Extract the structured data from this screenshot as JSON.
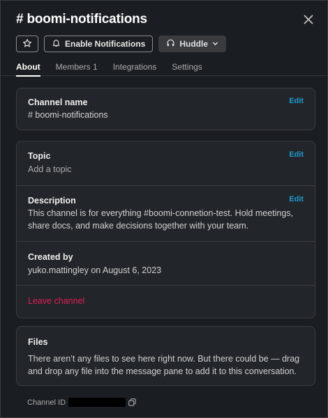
{
  "header": {
    "title": "# boomi-notifications",
    "buttons": {
      "enable_notifications": "Enable Notifications",
      "huddle": "Huddle"
    },
    "tabs": [
      {
        "label": "About",
        "active": true
      },
      {
        "label": "Members 1",
        "active": false
      },
      {
        "label": "Integrations",
        "active": false
      },
      {
        "label": "Settings",
        "active": false
      }
    ]
  },
  "channel_name": {
    "label": "Channel name",
    "value": "# boomi-notifications",
    "edit": "Edit"
  },
  "topic": {
    "label": "Topic",
    "placeholder": "Add a topic",
    "edit": "Edit"
  },
  "description": {
    "label": "Description",
    "value": "This channel is for everything #boomi-connetion-test. Hold meetings, share docs, and make decisions together with your team.",
    "edit": "Edit"
  },
  "created": {
    "label": "Created by",
    "value": "yuko.mattingley on August 6, 2023"
  },
  "leave": {
    "label": "Leave channel"
  },
  "files": {
    "label": "Files",
    "message": "There aren’t any files to see here right now. But there could be — drag and drop any file into the message pane to add it to this conversation."
  },
  "footer": {
    "channel_id_label": "Channel ID"
  },
  "colors": {
    "background": "#1a1d21",
    "card": "#222529",
    "link": "#1d9bd1",
    "danger": "#e01e5a"
  },
  "icons": [
    "star-icon",
    "bell-icon",
    "headphones-icon",
    "chevron-down-icon",
    "close-icon",
    "copy-icon"
  ]
}
